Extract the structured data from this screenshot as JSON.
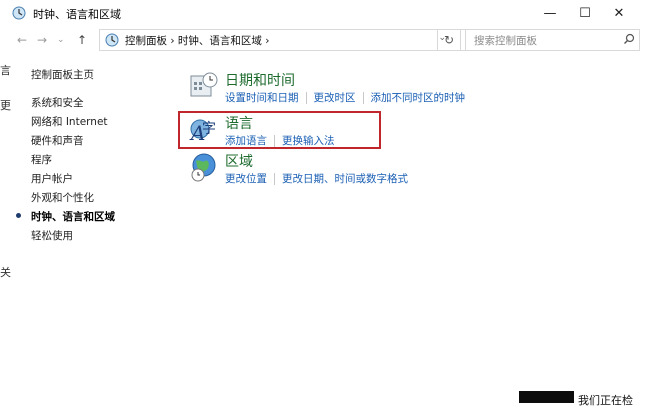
{
  "window": {
    "title": "时钟、语言和区域"
  },
  "address": {
    "path": "控制面板  ›  时钟、语言和区域  ›"
  },
  "search": {
    "placeholder": "搜索控制面板"
  },
  "sidebar": {
    "items": [
      {
        "label": "控制面板主页"
      },
      {
        "label": "系统和安全"
      },
      {
        "label": "网络和 Internet"
      },
      {
        "label": "硬件和声音"
      },
      {
        "label": "程序"
      },
      {
        "label": "用户帐户"
      },
      {
        "label": "外观和个性化"
      },
      {
        "label": "时钟、语言和区域",
        "active": true
      },
      {
        "label": "轻松使用"
      }
    ]
  },
  "categories": [
    {
      "title": "日期和时间",
      "links": [
        "设置时间和日期",
        "更改时区",
        "添加不同时区的时钟"
      ],
      "icon": "calendar-clock-icon"
    },
    {
      "title": "语言",
      "links": [
        "添加语言",
        "更换输入法"
      ],
      "icon": "language-icon"
    },
    {
      "title": "区域",
      "links": [
        "更改位置",
        "更改日期、时间或数字格式"
      ],
      "icon": "globe-clock-icon"
    }
  ],
  "left_fragments": [
    "言",
    "更",
    "关"
  ],
  "taskbar": {
    "text": "我们正在检"
  },
  "colors": {
    "highlight": "#c0272d",
    "link": "#1a5fb4",
    "category": "#1e6b2e"
  }
}
